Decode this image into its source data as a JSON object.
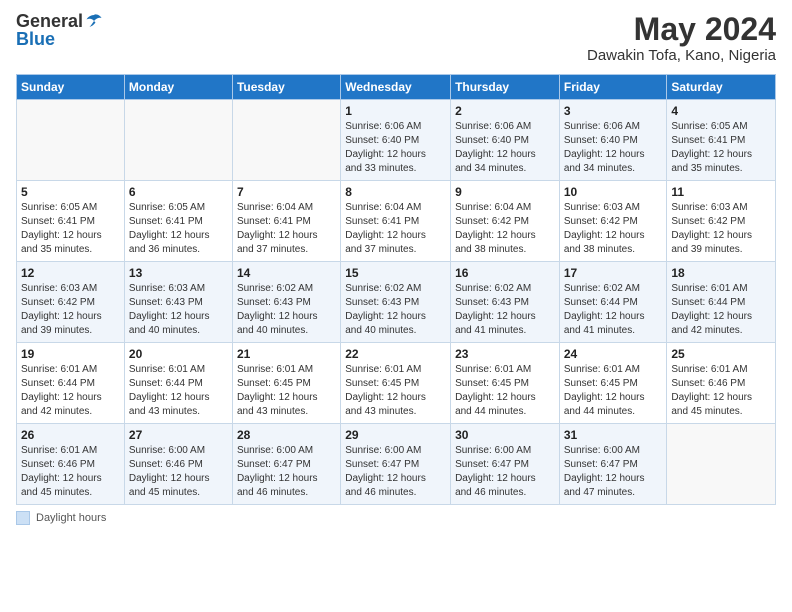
{
  "header": {
    "logo_general": "General",
    "logo_blue": "Blue",
    "title": "May 2024",
    "subtitle": "Dawakin Tofa, Kano, Nigeria"
  },
  "days_of_week": [
    "Sunday",
    "Monday",
    "Tuesday",
    "Wednesday",
    "Thursday",
    "Friday",
    "Saturday"
  ],
  "footer": {
    "label": "Daylight hours"
  },
  "weeks": [
    [
      {
        "day": "",
        "info": ""
      },
      {
        "day": "",
        "info": ""
      },
      {
        "day": "",
        "info": ""
      },
      {
        "day": "1",
        "info": "Sunrise: 6:06 AM\nSunset: 6:40 PM\nDaylight: 12 hours\nand 33 minutes."
      },
      {
        "day": "2",
        "info": "Sunrise: 6:06 AM\nSunset: 6:40 PM\nDaylight: 12 hours\nand 34 minutes."
      },
      {
        "day": "3",
        "info": "Sunrise: 6:06 AM\nSunset: 6:40 PM\nDaylight: 12 hours\nand 34 minutes."
      },
      {
        "day": "4",
        "info": "Sunrise: 6:05 AM\nSunset: 6:41 PM\nDaylight: 12 hours\nand 35 minutes."
      }
    ],
    [
      {
        "day": "5",
        "info": "Sunrise: 6:05 AM\nSunset: 6:41 PM\nDaylight: 12 hours\nand 35 minutes."
      },
      {
        "day": "6",
        "info": "Sunrise: 6:05 AM\nSunset: 6:41 PM\nDaylight: 12 hours\nand 36 minutes."
      },
      {
        "day": "7",
        "info": "Sunrise: 6:04 AM\nSunset: 6:41 PM\nDaylight: 12 hours\nand 37 minutes."
      },
      {
        "day": "8",
        "info": "Sunrise: 6:04 AM\nSunset: 6:41 PM\nDaylight: 12 hours\nand 37 minutes."
      },
      {
        "day": "9",
        "info": "Sunrise: 6:04 AM\nSunset: 6:42 PM\nDaylight: 12 hours\nand 38 minutes."
      },
      {
        "day": "10",
        "info": "Sunrise: 6:03 AM\nSunset: 6:42 PM\nDaylight: 12 hours\nand 38 minutes."
      },
      {
        "day": "11",
        "info": "Sunrise: 6:03 AM\nSunset: 6:42 PM\nDaylight: 12 hours\nand 39 minutes."
      }
    ],
    [
      {
        "day": "12",
        "info": "Sunrise: 6:03 AM\nSunset: 6:42 PM\nDaylight: 12 hours\nand 39 minutes."
      },
      {
        "day": "13",
        "info": "Sunrise: 6:03 AM\nSunset: 6:43 PM\nDaylight: 12 hours\nand 40 minutes."
      },
      {
        "day": "14",
        "info": "Sunrise: 6:02 AM\nSunset: 6:43 PM\nDaylight: 12 hours\nand 40 minutes."
      },
      {
        "day": "15",
        "info": "Sunrise: 6:02 AM\nSunset: 6:43 PM\nDaylight: 12 hours\nand 40 minutes."
      },
      {
        "day": "16",
        "info": "Sunrise: 6:02 AM\nSunset: 6:43 PM\nDaylight: 12 hours\nand 41 minutes."
      },
      {
        "day": "17",
        "info": "Sunrise: 6:02 AM\nSunset: 6:44 PM\nDaylight: 12 hours\nand 41 minutes."
      },
      {
        "day": "18",
        "info": "Sunrise: 6:01 AM\nSunset: 6:44 PM\nDaylight: 12 hours\nand 42 minutes."
      }
    ],
    [
      {
        "day": "19",
        "info": "Sunrise: 6:01 AM\nSunset: 6:44 PM\nDaylight: 12 hours\nand 42 minutes."
      },
      {
        "day": "20",
        "info": "Sunrise: 6:01 AM\nSunset: 6:44 PM\nDaylight: 12 hours\nand 43 minutes."
      },
      {
        "day": "21",
        "info": "Sunrise: 6:01 AM\nSunset: 6:45 PM\nDaylight: 12 hours\nand 43 minutes."
      },
      {
        "day": "22",
        "info": "Sunrise: 6:01 AM\nSunset: 6:45 PM\nDaylight: 12 hours\nand 43 minutes."
      },
      {
        "day": "23",
        "info": "Sunrise: 6:01 AM\nSunset: 6:45 PM\nDaylight: 12 hours\nand 44 minutes."
      },
      {
        "day": "24",
        "info": "Sunrise: 6:01 AM\nSunset: 6:45 PM\nDaylight: 12 hours\nand 44 minutes."
      },
      {
        "day": "25",
        "info": "Sunrise: 6:01 AM\nSunset: 6:46 PM\nDaylight: 12 hours\nand 45 minutes."
      }
    ],
    [
      {
        "day": "26",
        "info": "Sunrise: 6:01 AM\nSunset: 6:46 PM\nDaylight: 12 hours\nand 45 minutes."
      },
      {
        "day": "27",
        "info": "Sunrise: 6:00 AM\nSunset: 6:46 PM\nDaylight: 12 hours\nand 45 minutes."
      },
      {
        "day": "28",
        "info": "Sunrise: 6:00 AM\nSunset: 6:47 PM\nDaylight: 12 hours\nand 46 minutes."
      },
      {
        "day": "29",
        "info": "Sunrise: 6:00 AM\nSunset: 6:47 PM\nDaylight: 12 hours\nand 46 minutes."
      },
      {
        "day": "30",
        "info": "Sunrise: 6:00 AM\nSunset: 6:47 PM\nDaylight: 12 hours\nand 46 minutes."
      },
      {
        "day": "31",
        "info": "Sunrise: 6:00 AM\nSunset: 6:47 PM\nDaylight: 12 hours\nand 47 minutes."
      },
      {
        "day": "",
        "info": ""
      }
    ]
  ]
}
